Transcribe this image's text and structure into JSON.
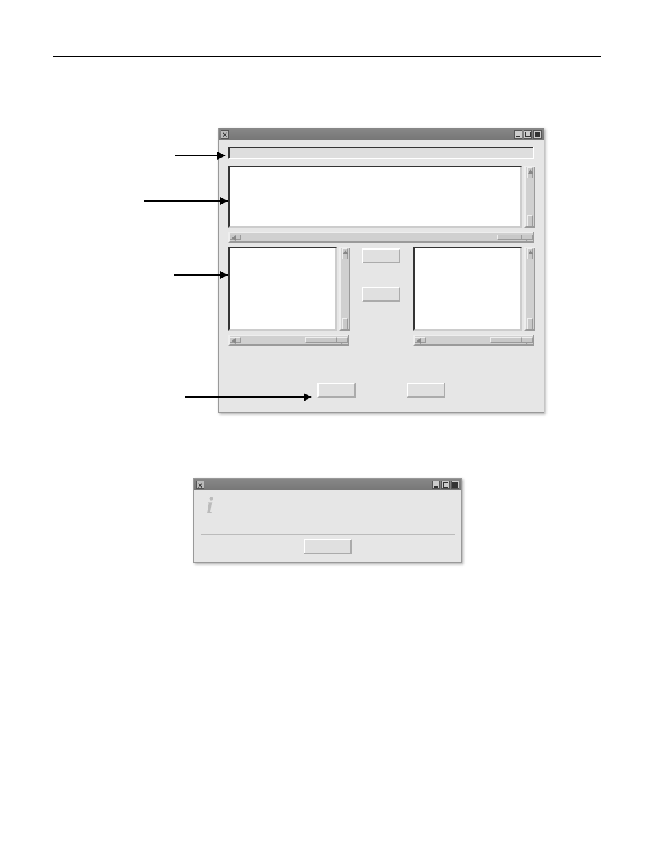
{
  "page": {
    "rule": true
  },
  "main_dialog": {
    "system_menu_glyph": "X",
    "text_field_value": "",
    "add_button_label": "",
    "remove_button_label": "",
    "ok_button_label": "",
    "cancel_button_label": ""
  },
  "info_dialog": {
    "system_menu_glyph": "X",
    "info_icon_glyph": "i",
    "message": "",
    "ok_button_label": ""
  },
  "callouts": {
    "field_label": "",
    "list_label": "",
    "side_list_label": "",
    "button_row_label": ""
  }
}
